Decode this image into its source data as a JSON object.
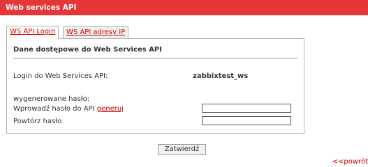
{
  "header": {
    "title": "Web services API"
  },
  "tabs": [
    {
      "label": "WS API Login",
      "active": true
    },
    {
      "label": "WS API adresy IP",
      "active": false
    }
  ],
  "section": {
    "title": "Dane dostępowe do Web Services API"
  },
  "login": {
    "label": "Login do Web Services API:",
    "value": "zabbixtest_ws"
  },
  "generated": {
    "label": "wygenerowane hasło:"
  },
  "password": {
    "label": "Wprowadź hasło do API",
    "generate_link": "generuj",
    "value": ""
  },
  "repeat": {
    "label": "Powtórz hasło",
    "value": ""
  },
  "actions": {
    "submit_label": "Zatwierdź",
    "back_label": "<<powrót"
  },
  "colors": {
    "accent": "#e5363a",
    "link": "#cc0000"
  }
}
